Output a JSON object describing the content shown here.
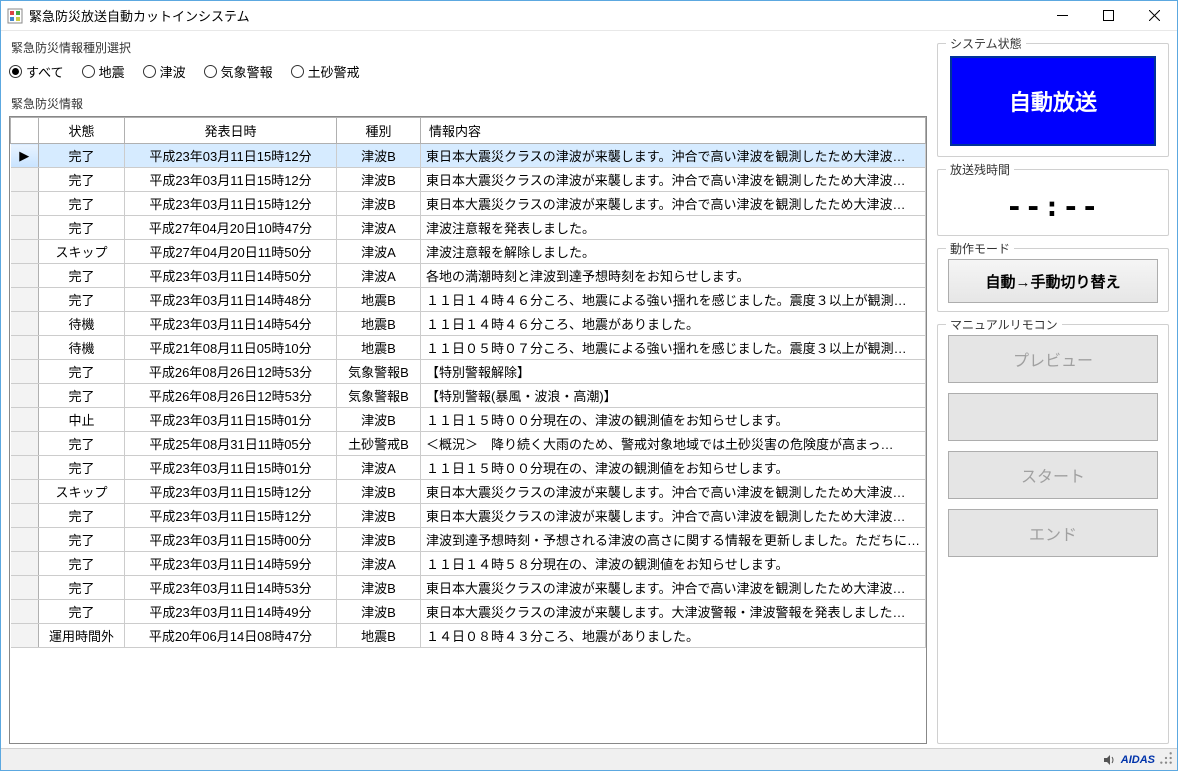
{
  "window_title": "緊急防災放送自動カットインシステム",
  "filter": {
    "label": "緊急防災情報種別選択",
    "options": [
      {
        "label": "すべて",
        "checked": true
      },
      {
        "label": "地震",
        "checked": false
      },
      {
        "label": "津波",
        "checked": false
      },
      {
        "label": "気象警報",
        "checked": false
      },
      {
        "label": "土砂警戒",
        "checked": false
      }
    ]
  },
  "list": {
    "label": "緊急防災情報",
    "headers": {
      "status": "状態",
      "date": "発表日時",
      "type": "種別",
      "content": "情報内容"
    },
    "rows": [
      {
        "marker": "▶",
        "status": "完了",
        "date": "平成23年03月11日15時12分",
        "type": "津波B",
        "content": "東日本大震災クラスの津波が来襲します。沖合で高い津波を観測したため大津波…",
        "selected": true
      },
      {
        "marker": "",
        "status": "完了",
        "date": "平成23年03月11日15時12分",
        "type": "津波B",
        "content": "東日本大震災クラスの津波が来襲します。沖合で高い津波を観測したため大津波…"
      },
      {
        "marker": "",
        "status": "完了",
        "date": "平成23年03月11日15時12分",
        "type": "津波B",
        "content": "東日本大震災クラスの津波が来襲します。沖合で高い津波を観測したため大津波…"
      },
      {
        "marker": "",
        "status": "完了",
        "date": "平成27年04月20日10時47分",
        "type": "津波A",
        "content": "津波注意報を発表しました。"
      },
      {
        "marker": "",
        "status": "スキップ",
        "date": "平成27年04月20日11時50分",
        "type": "津波A",
        "content": "津波注意報を解除しました。"
      },
      {
        "marker": "",
        "status": "完了",
        "date": "平成23年03月11日14時50分",
        "type": "津波A",
        "content": "各地の満潮時刻と津波到達予想時刻をお知らせします。"
      },
      {
        "marker": "",
        "status": "完了",
        "date": "平成23年03月11日14時48分",
        "type": "地震B",
        "content": "１１日１４時４６分ころ、地震による強い揺れを感じました。震度３以上が観測…"
      },
      {
        "marker": "",
        "status": "待機",
        "date": "平成23年03月11日14時54分",
        "type": "地震B",
        "content": "１１日１４時４６分ころ、地震がありました。"
      },
      {
        "marker": "",
        "status": "待機",
        "date": "平成21年08月11日05時10分",
        "type": "地震B",
        "content": "１１日０５時０７分ころ、地震による強い揺れを感じました。震度３以上が観測…"
      },
      {
        "marker": "",
        "status": "完了",
        "date": "平成26年08月26日12時53分",
        "type": "気象警報B",
        "content": "【特別警報解除】"
      },
      {
        "marker": "",
        "status": "完了",
        "date": "平成26年08月26日12時53分",
        "type": "気象警報B",
        "content": "【特別警報(暴風・波浪・高潮)】"
      },
      {
        "marker": "",
        "status": "中止",
        "date": "平成23年03月11日15時01分",
        "type": "津波B",
        "content": "１１日１５時００分現在の、津波の観測値をお知らせします。"
      },
      {
        "marker": "",
        "status": "完了",
        "date": "平成25年08月31日11時05分",
        "type": "土砂警戒B",
        "content": "＜概況＞　降り続く大雨のため、警戒対象地域では土砂災害の危険度が高まっ…"
      },
      {
        "marker": "",
        "status": "完了",
        "date": "平成23年03月11日15時01分",
        "type": "津波A",
        "content": "１１日１５時００分現在の、津波の観測値をお知らせします。"
      },
      {
        "marker": "",
        "status": "スキップ",
        "date": "平成23年03月11日15時12分",
        "type": "津波B",
        "content": "東日本大震災クラスの津波が来襲します。沖合で高い津波を観測したため大津波…"
      },
      {
        "marker": "",
        "status": "完了",
        "date": "平成23年03月11日15時12分",
        "type": "津波B",
        "content": "東日本大震災クラスの津波が来襲します。沖合で高い津波を観測したため大津波…"
      },
      {
        "marker": "",
        "status": "完了",
        "date": "平成23年03月11日15時00分",
        "type": "津波B",
        "content": "津波到達予想時刻・予想される津波の高さに関する情報を更新しました。ただちに…"
      },
      {
        "marker": "",
        "status": "完了",
        "date": "平成23年03月11日14時59分",
        "type": "津波A",
        "content": "１１日１４時５８分現在の、津波の観測値をお知らせします。"
      },
      {
        "marker": "",
        "status": "完了",
        "date": "平成23年03月11日14時53分",
        "type": "津波B",
        "content": "東日本大震災クラスの津波が来襲します。沖合で高い津波を観測したため大津波…"
      },
      {
        "marker": "",
        "status": "完了",
        "date": "平成23年03月11日14時49分",
        "type": "津波B",
        "content": "東日本大震災クラスの津波が来襲します。大津波警報・津波警報を発表しました…"
      },
      {
        "marker": "",
        "status": "運用時間外",
        "date": "平成20年06月14日08時47分",
        "type": "地震B",
        "content": "１４日０８時４３分ころ、地震がありました。"
      }
    ]
  },
  "system_status": {
    "label": "システム状態",
    "value": "自動放送"
  },
  "remaining_time": {
    "label": "放送残時間",
    "value": "--:--"
  },
  "mode": {
    "label": "動作モード",
    "button": "自動→手動切り替え"
  },
  "remote": {
    "label": "マニュアルリモコン",
    "buttons": {
      "preview": "プレビュー",
      "blank": "",
      "start": "スタート",
      "end": "エンド"
    }
  },
  "footer_brand": "AIDAS"
}
